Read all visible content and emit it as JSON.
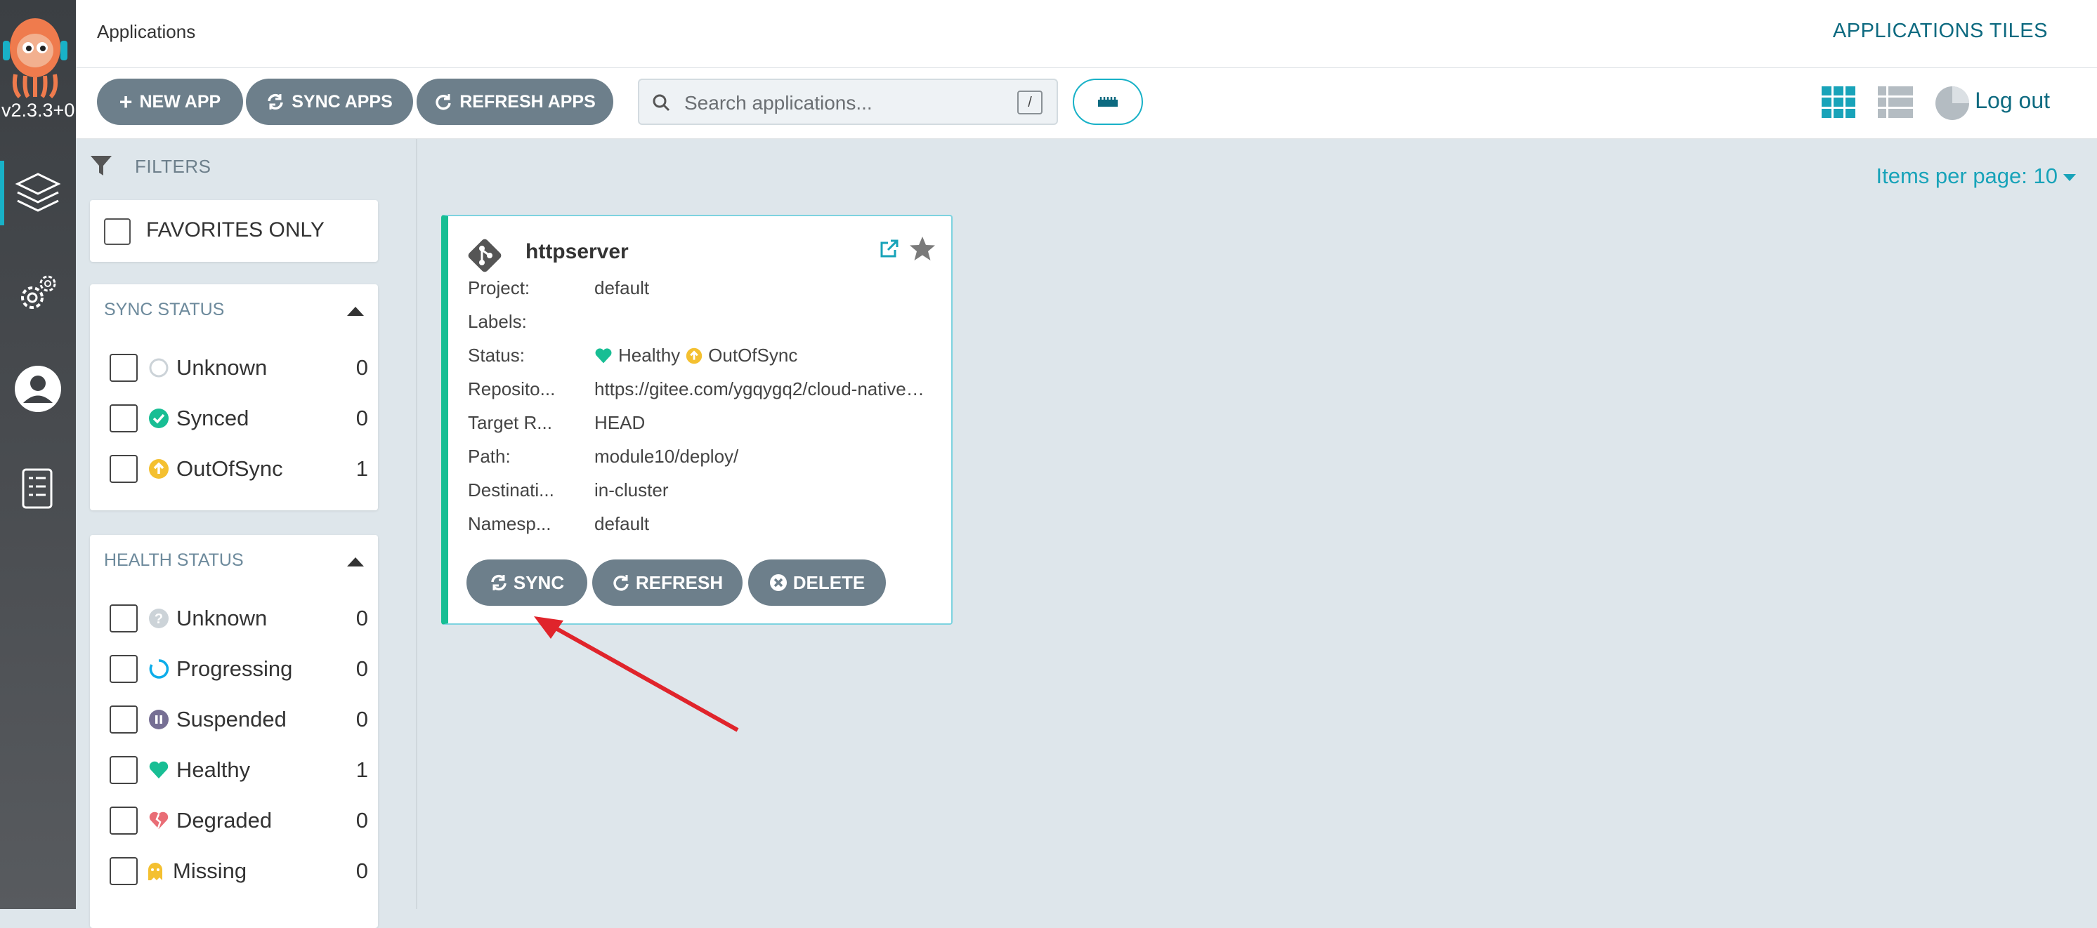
{
  "sidebar": {
    "version": "v2.3.3+0",
    "nav": [
      "applications-icon",
      "settings-icon",
      "user-icon",
      "docs-icon"
    ]
  },
  "header": {
    "title": "Applications",
    "view_title": "APPLICATIONS TILES"
  },
  "toolbar": {
    "new_app": "NEW APP",
    "sync_apps": "SYNC APPS",
    "refresh_apps": "REFRESH APPS",
    "search_placeholder": "Search applications...",
    "search_shortcut": "/",
    "logout": "Log out"
  },
  "filters": {
    "title": "FILTERS",
    "favorites_only": "FAVORITES ONLY",
    "sync_status": {
      "heading": "SYNC STATUS",
      "items": [
        {
          "label": "Unknown",
          "count": "0",
          "icon": "circle-outline-icon"
        },
        {
          "label": "Synced",
          "count": "0",
          "icon": "check-circle-icon"
        },
        {
          "label": "OutOfSync",
          "count": "1",
          "icon": "arrow-up-circle-icon"
        }
      ]
    },
    "health_status": {
      "heading": "HEALTH STATUS",
      "items": [
        {
          "label": "Unknown",
          "count": "0",
          "icon": "question-circle-icon"
        },
        {
          "label": "Progressing",
          "count": "0",
          "icon": "spinner-icon"
        },
        {
          "label": "Suspended",
          "count": "0",
          "icon": "pause-circle-icon"
        },
        {
          "label": "Healthy",
          "count": "1",
          "icon": "heart-icon"
        },
        {
          "label": "Degraded",
          "count": "0",
          "icon": "broken-heart-icon"
        },
        {
          "label": "Missing",
          "count": "0",
          "icon": "ghost-icon"
        }
      ]
    }
  },
  "pagination": {
    "items_per_page": "Items per page: 10"
  },
  "app_card": {
    "name": "httpserver",
    "fields": [
      {
        "key": "Project:",
        "value": "default"
      },
      {
        "key": "Labels:",
        "value": ""
      },
      {
        "key": "Status:",
        "value": ""
      },
      {
        "key": "Reposito...",
        "value": "https://gitee.com/ygqygq2/cloud-native…"
      },
      {
        "key": "Target R...",
        "value": "HEAD"
      },
      {
        "key": "Path:",
        "value": "module10/deploy/"
      },
      {
        "key": "Destinati...",
        "value": "in-cluster"
      },
      {
        "key": "Namesp...",
        "value": "default"
      }
    ],
    "health": "Healthy",
    "sync": "OutOfSync",
    "buttons": {
      "sync": "SYNC",
      "refresh": "REFRESH",
      "delete": "DELETE"
    }
  },
  "colors": {
    "accent": "#18b1c7",
    "healthy": "#18be94",
    "out_of_sync": "#f4c030",
    "button": "#6d7f8b",
    "annotation_arrow": "#e0242b"
  }
}
